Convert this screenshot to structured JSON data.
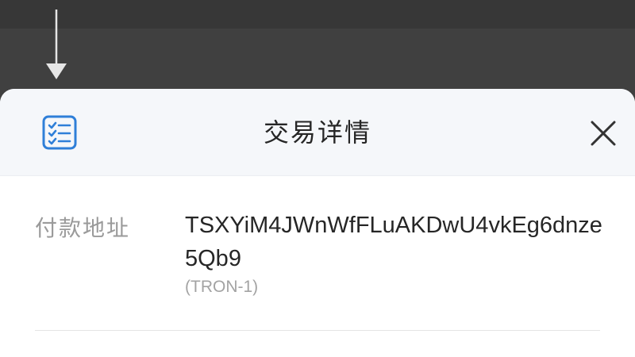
{
  "sheet": {
    "title": "交易详情",
    "header_icon": "checklist-icon",
    "close_icon": "close-icon"
  },
  "overlay": {
    "hint_icon": "arrow-down-icon"
  },
  "detail": {
    "label": "付款地址",
    "address": "TSXYiM4JWnWfFLuAKDwU4vkEg6dnze5Qb9",
    "network": "(TRON-1)"
  },
  "colors": {
    "accent": "#2f7fd8",
    "overlay": "#404040",
    "header_bg": "#f5f7fa",
    "label": "#9a9a9a",
    "value": "#262626"
  }
}
